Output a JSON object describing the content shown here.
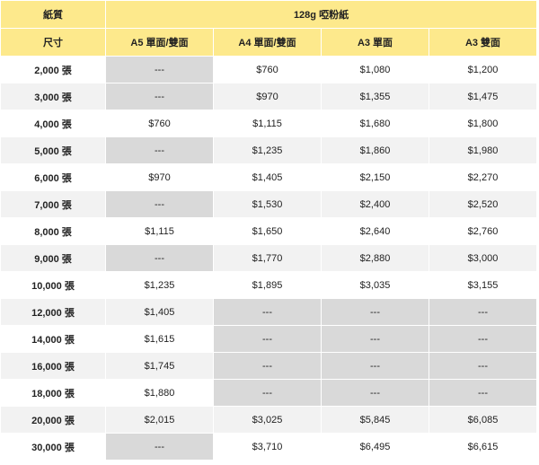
{
  "header": {
    "paper_label": "紙質",
    "paper_name": "128g 啞粉紙",
    "size_label": "尺寸",
    "columns": [
      "A5 單面/雙面",
      "A4 單面/雙面",
      "A3 單面",
      "A3 雙面"
    ]
  },
  "rows": [
    {
      "qty": "2,000 張",
      "cells": [
        "---",
        "$760",
        "$1,080",
        "$1,200"
      ]
    },
    {
      "qty": "3,000 張",
      "cells": [
        "---",
        "$970",
        "$1,355",
        "$1,475"
      ]
    },
    {
      "qty": "4,000 張",
      "cells": [
        "$760",
        "$1,115",
        "$1,680",
        "$1,800"
      ]
    },
    {
      "qty": "5,000 張",
      "cells": [
        "---",
        "$1,235",
        "$1,860",
        "$1,980"
      ]
    },
    {
      "qty": "6,000 張",
      "cells": [
        "$970",
        "$1,405",
        "$2,150",
        "$2,270"
      ]
    },
    {
      "qty": "7,000 張",
      "cells": [
        "---",
        "$1,530",
        "$2,400",
        "$2,520"
      ]
    },
    {
      "qty": "8,000 張",
      "cells": [
        "$1,115",
        "$1,650",
        "$2,640",
        "$2,760"
      ]
    },
    {
      "qty": "9,000 張",
      "cells": [
        "---",
        "$1,770",
        "$2,880",
        "$3,000"
      ]
    },
    {
      "qty": "10,000 張",
      "cells": [
        "$1,235",
        "$1,895",
        "$3,035",
        "$3,155"
      ]
    },
    {
      "qty": "12,000 張",
      "cells": [
        "$1,405",
        "---",
        "---",
        "---"
      ]
    },
    {
      "qty": "14,000 張",
      "cells": [
        "$1,615",
        "---",
        "---",
        "---"
      ]
    },
    {
      "qty": "16,000 張",
      "cells": [
        "$1,745",
        "---",
        "---",
        "---"
      ]
    },
    {
      "qty": "18,000 張",
      "cells": [
        "$1,880",
        "---",
        "---",
        "---"
      ]
    },
    {
      "qty": "20,000 張",
      "cells": [
        "$2,015",
        "$3,025",
        "$5,845",
        "$6,085"
      ]
    },
    {
      "qty": "30,000 張",
      "cells": [
        "---",
        "$3,710",
        "$6,495",
        "$6,615"
      ]
    }
  ],
  "colors": {
    "header_bg": "#fde98c",
    "unavailable_bg": "#d9d9d9",
    "alt_row_bg": "#f2f2f2"
  }
}
